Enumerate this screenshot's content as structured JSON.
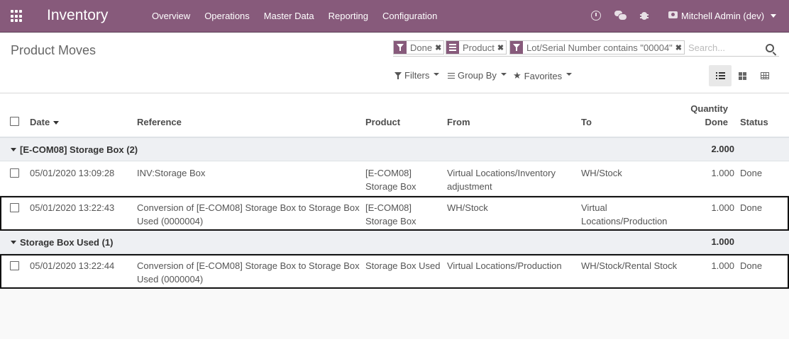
{
  "navbar": {
    "app_name": "Inventory",
    "menu": [
      "Overview",
      "Operations",
      "Master Data",
      "Reporting",
      "Configuration"
    ],
    "user": "Mitchell Admin (dev)",
    "icons": [
      "apps-icon",
      "clock-icon",
      "chat-icon",
      "bug-icon",
      "user-icon"
    ]
  },
  "control_panel": {
    "title": "Product Moves",
    "facets": [
      "Done",
      "Product",
      "Lot/Serial Number contains \"00004\""
    ],
    "search_placeholder": "Search...",
    "filters_label": "Filters",
    "groupby_label": "Group By",
    "favorites_label": "Favorites"
  },
  "table": {
    "headers": {
      "date": "Date",
      "reference": "Reference",
      "product": "Product",
      "from": "From",
      "to": "To",
      "qty_line1": "Quantity",
      "qty_line2": "Done",
      "status": "Status"
    },
    "groups": [
      {
        "name": "[E-COM08] Storage Box (2)",
        "total": "2.000",
        "rows": [
          {
            "date": "05/01/2020 13:09:28",
            "reference": "INV:Storage Box",
            "product": "[E-COM08] Storage Box",
            "from": "Virtual Locations/Inventory adjustment",
            "to": "WH/Stock",
            "qty": "1.000",
            "status": "Done"
          },
          {
            "date": "05/01/2020 13:22:43",
            "reference": "Conversion of [E-COM08] Storage Box to Storage Box Used (0000004)",
            "product": "[E-COM08] Storage Box",
            "from": "WH/Stock",
            "to": "Virtual Locations/Production",
            "qty": "1.000",
            "status": "Done"
          }
        ]
      },
      {
        "name": "Storage Box Used (1)",
        "total": "1.000",
        "rows": [
          {
            "date": "05/01/2020 13:22:44",
            "reference": "Conversion of [E-COM08] Storage Box to Storage Box Used (0000004)",
            "product": "Storage Box Used",
            "from": "Virtual Locations/Production",
            "to": "WH/Stock/Rental Stock",
            "qty": "1.000",
            "status": "Done"
          }
        ]
      }
    ]
  },
  "colors": {
    "brand": "#875a7b",
    "group_bg": "#eef0f3"
  }
}
